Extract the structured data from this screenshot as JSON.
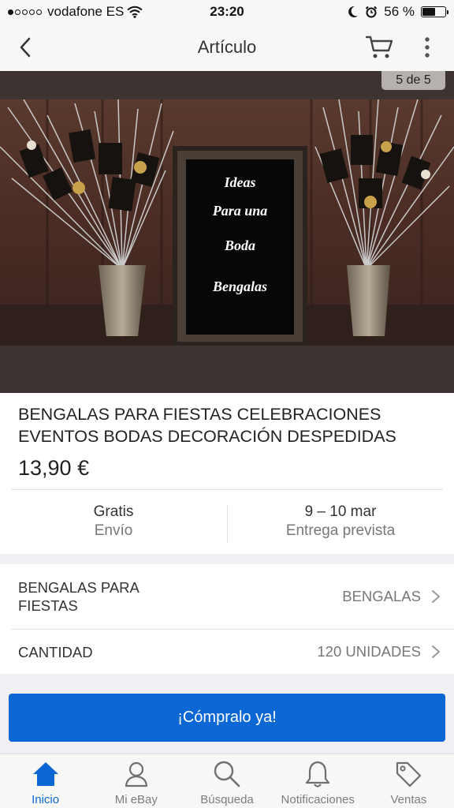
{
  "status_bar": {
    "carrier": "vodafone ES",
    "time": "23:20",
    "battery": "56 %",
    "battery_level": 0.56
  },
  "nav": {
    "title": "Artículo",
    "icons": {
      "back": "chevron-left-icon",
      "cart": "cart-icon",
      "more": "more-vertical-icon"
    }
  },
  "gallery": {
    "counter": "5 de 5",
    "image_text": [
      "Ideas",
      "Para una",
      "Boda",
      "Bengalas"
    ]
  },
  "item": {
    "title": "BENGALAS PARA FIESTAS CELEBRACIONES EVENTOS BODAS DECORACIÓN DESPEDIDAS",
    "price": "13,90 €",
    "shipping": {
      "value": "Gratis",
      "label": "Envío"
    },
    "delivery": {
      "value": "9 – 10 mar",
      "label": "Entrega prevista"
    }
  },
  "variations": [
    {
      "label": "BENGALAS PARA FIESTAS",
      "value": "BENGALAS"
    },
    {
      "label": "CANTIDAD",
      "value": "120 UNIDADES"
    }
  ],
  "buy_button": {
    "label": "¡Cómpralo ya!",
    "color": "#0a67d4"
  },
  "tab_bar": {
    "active_color": "#0a67d4",
    "tabs": [
      {
        "label": "Inicio",
        "icon": "home-icon",
        "active": true
      },
      {
        "label": "Mi eBay",
        "icon": "user-icon",
        "active": false
      },
      {
        "label": "Búsqueda",
        "icon": "search-icon",
        "active": false
      },
      {
        "label": "Notificaciones",
        "icon": "bell-icon",
        "active": false
      },
      {
        "label": "Ventas",
        "icon": "tag-icon",
        "active": false
      }
    ]
  }
}
